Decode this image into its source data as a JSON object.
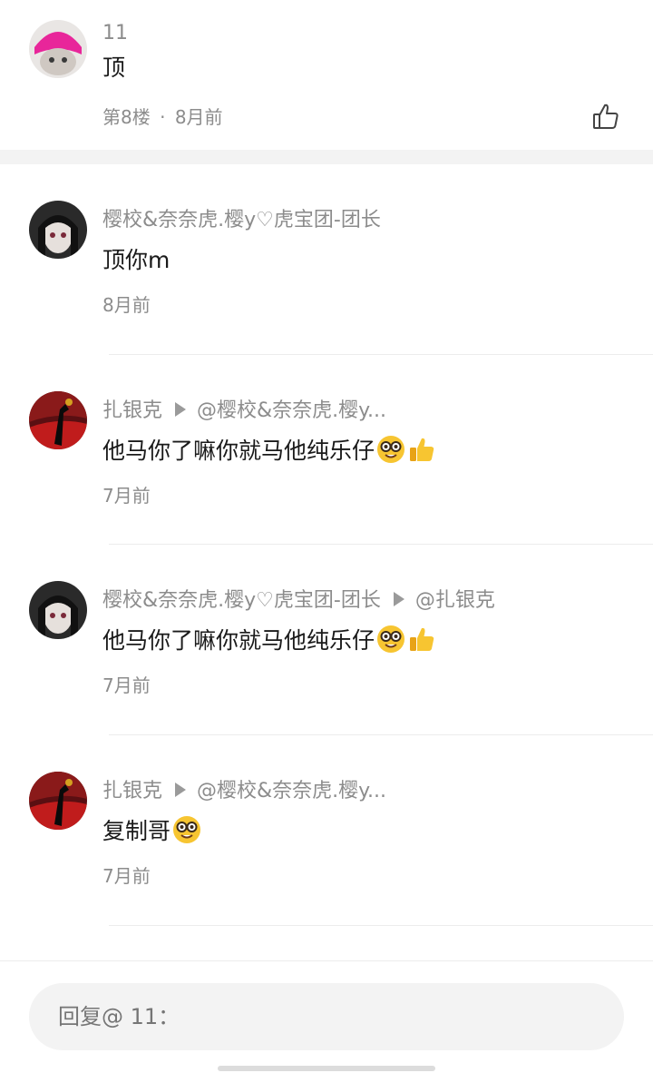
{
  "top_comment": {
    "username": "11",
    "content": "顶",
    "floor": "第8楼",
    "separator": "·",
    "time": "8月前"
  },
  "replies": [
    {
      "username": "樱校&奈奈虎.樱y♡虎宝团-团长",
      "target": "",
      "content": "顶你m",
      "time": "8月前"
    },
    {
      "username": "扎银克",
      "target": "@樱校&奈奈虎.樱y...",
      "content": "他马你了嘛你就马他纯乐仔",
      "time": "7月前"
    },
    {
      "username": "樱校&奈奈虎.樱y♡虎宝团-团长",
      "target": "@扎银克",
      "content": "他马你了嘛你就马他纯乐仔",
      "time": "7月前"
    },
    {
      "username": "扎银克",
      "target": "@樱校&奈奈虎.樱y...",
      "content": "复制哥",
      "time": "7月前"
    }
  ],
  "reply_input": {
    "placeholder": "回复@ 11："
  },
  "icons": {
    "like": "thumbs-up-outline-icon",
    "nerd_emoji": "nerd-face-emoji",
    "thumbs_emoji": "thumbs-up-emoji",
    "reply_arrow": "triangle-right-icon"
  }
}
